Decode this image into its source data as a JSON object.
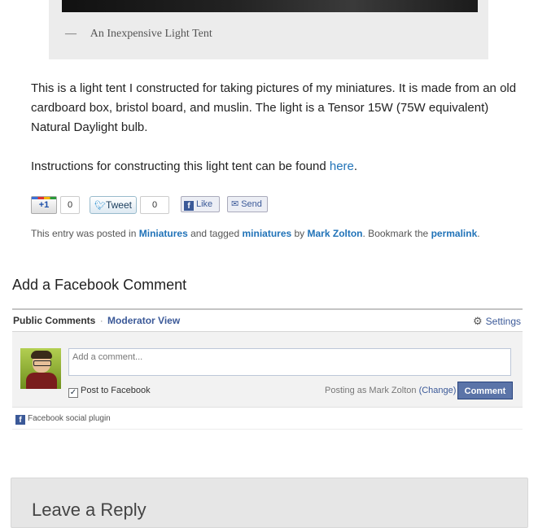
{
  "caption": {
    "dash": "—",
    "text": "An Inexpensive Light Tent"
  },
  "post": {
    "paragraph1": "This is a light tent I constructed for taking pictures of my miniatures. It is made from an old cardboard box, bristol board, and muslin. The light is a Tensor 15W (75W equivalent) Natural Daylight bulb.",
    "paragraph2_prefix": "Instructions for constructing this light tent can be found ",
    "paragraph2_link": "here",
    "paragraph2_suffix": "."
  },
  "social": {
    "gplus_label": "+1",
    "gplus_count": "0",
    "tweet_label": "Tweet",
    "tweet_count": "0",
    "like_label": "Like",
    "send_label": "Send"
  },
  "entry_meta": {
    "prefix": "This entry was posted in ",
    "category": "Miniatures",
    "tagged_text": " and tagged ",
    "tag": "miniatures",
    "by_text": " by ",
    "author": "Mark Zolton",
    "bookmark_text": ". Bookmark the ",
    "permalink": "permalink",
    "end": "."
  },
  "facebook": {
    "heading": "Add a Facebook Comment",
    "tab_public": "Public Comments",
    "tab_separator": "·",
    "tab_moderator": "Moderator View",
    "settings": "Settings",
    "input_placeholder": "Add a comment...",
    "post_to_facebook": "Post to Facebook",
    "posting_as": "Posting as Mark Zolton",
    "change": "(Change)",
    "comment_button": "Comment",
    "plugin_text": "Facebook social plugin"
  },
  "reply": {
    "title": "Leave a Reply"
  },
  "colors": {
    "link": "#2173b8",
    "facebook_blue": "#3b5998",
    "comment_button": "#5b74a8"
  }
}
